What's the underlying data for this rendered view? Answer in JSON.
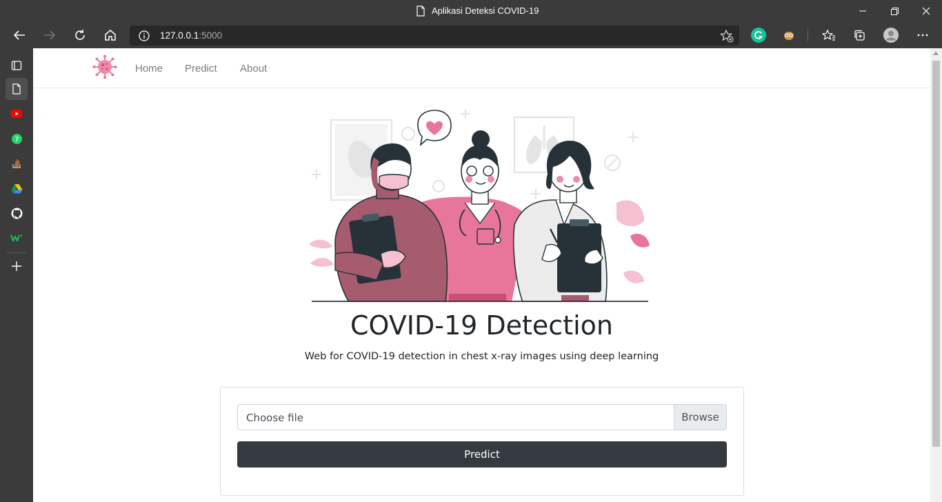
{
  "window": {
    "title": "Aplikasi Deteksi COVID-19"
  },
  "address_bar": {
    "host": "127.0.0.1",
    "port": ":5000"
  },
  "sidebar": {
    "items": [
      {
        "icon": "tab-actions-icon"
      },
      {
        "icon": "page-icon",
        "active": true
      },
      {
        "icon": "youtube-icon"
      },
      {
        "icon": "whatsapp-icon",
        "badge": "7"
      },
      {
        "icon": "stackoverflow-icon"
      },
      {
        "icon": "google-drive-icon"
      },
      {
        "icon": "github-icon"
      },
      {
        "icon": "w-logo-icon",
        "text": "W"
      },
      {
        "icon": "add-icon"
      }
    ]
  },
  "navbar": {
    "links": [
      "Home",
      "Predict",
      "About"
    ]
  },
  "hero": {
    "title": "COVID-19 Detection",
    "subtitle": "Web for COVID-19 detection in chest x-ray images using deep learning"
  },
  "form": {
    "file_placeholder": "Choose file",
    "browse_label": "Browse",
    "submit_label": "Predict"
  },
  "colors": {
    "accent_pink": "#e8769a",
    "dark_button": "#343a40",
    "maroon": "#a65b6f"
  }
}
